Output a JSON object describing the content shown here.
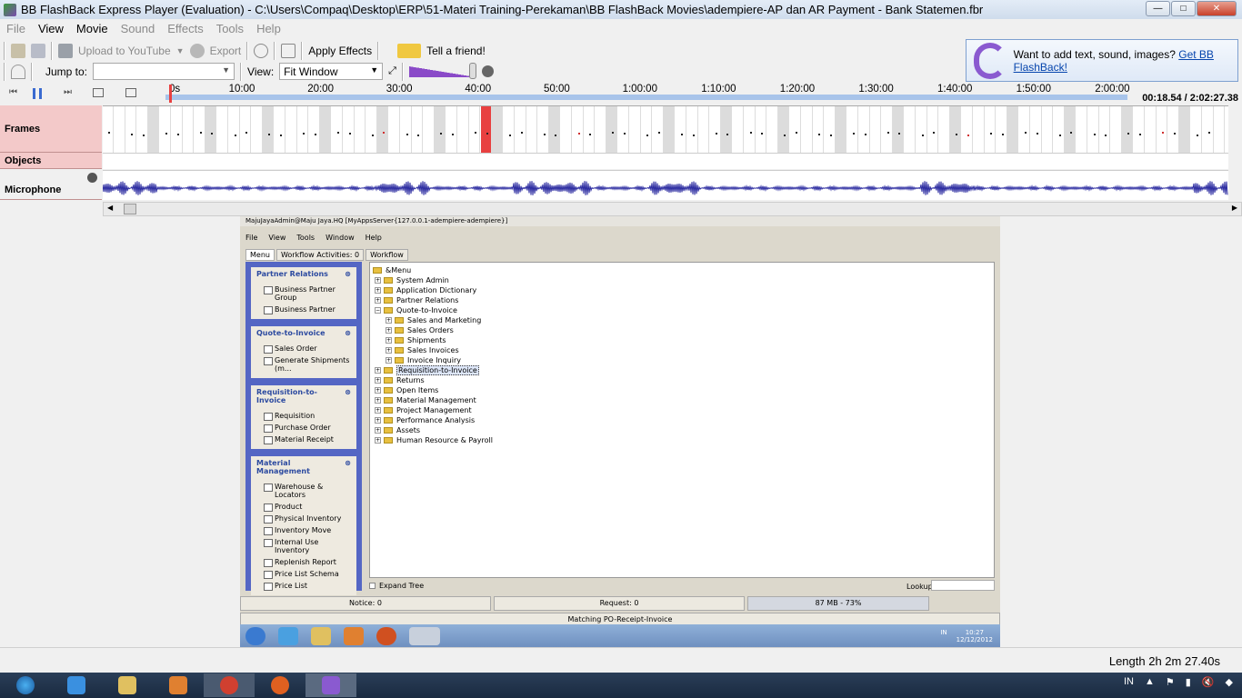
{
  "window": {
    "title": "BB FlashBack Express Player (Evaluation) - C:\\Users\\Compaq\\Desktop\\ERP\\51-Materi Training-Perekaman\\BB FlashBack Movies\\adempiere-AP dan AR Payment - Bank Statemen.fbr",
    "minimize": "—",
    "maximize": "□",
    "close": "✕"
  },
  "menu": [
    {
      "label": "File",
      "enabled": false
    },
    {
      "label": "View",
      "enabled": true
    },
    {
      "label": "Movie",
      "enabled": true
    },
    {
      "label": "Sound",
      "enabled": false
    },
    {
      "label": "Effects",
      "enabled": false
    },
    {
      "label": "Tools",
      "enabled": false
    },
    {
      "label": "Help",
      "enabled": false
    }
  ],
  "toolbar": {
    "upload": "Upload to YouTube",
    "export": "Export",
    "apply_effects": "Apply Effects",
    "tell_friend": "Tell a friend!",
    "jump_to": "Jump to:",
    "jump_value": "",
    "view": "View:",
    "view_value": "Fit Window"
  },
  "promo": {
    "text": "Want to add text, sound, images?",
    "link": "Get BB FlashBack!"
  },
  "timeline": {
    "ticks": [
      "0s",
      "10:00",
      "20:00",
      "30:00",
      "40:00",
      "50:00",
      "1:00:00",
      "1:10:00",
      "1:20:00",
      "1:30:00",
      "1:40:00",
      "1:50:00",
      "2:00:00"
    ],
    "timecode": "00:18.54 / 2:02:27.38",
    "tracks": [
      "Frames",
      "Objects",
      "Microphone"
    ],
    "playhead_fraction": 0.0025,
    "accent": "#e84040"
  },
  "recording": {
    "title": "MajuJayaAdmin@Maju Jaya.HQ [MyAppsServer{127.0.0.1-adempiere-adempiere}]",
    "menu": [
      "File",
      "View",
      "Tools",
      "Window",
      "Help"
    ],
    "tabs": [
      "Menu",
      "Workflow Activities: 0",
      "Workflow"
    ],
    "panels": [
      {
        "title": "Partner Relations",
        "items": [
          "Business Partner Group",
          "Business Partner"
        ]
      },
      {
        "title": "Quote-to-Invoice",
        "items": [
          "Sales Order",
          "Generate Shipments (m..."
        ]
      },
      {
        "title": "Requisition-to-Invoice",
        "items": [
          "Requisition",
          "Purchase Order",
          "Material Receipt"
        ]
      },
      {
        "title": "Material Management",
        "items": [
          "Warehouse & Locators",
          "Product",
          "Physical Inventory",
          "Inventory Move",
          "Internal Use Inventory",
          "Replenish Report",
          "Price List Schema",
          "Price List"
        ]
      }
    ],
    "tree": [
      {
        "label": "&Menu",
        "level": 0,
        "root": true
      },
      {
        "label": "System Admin",
        "level": 1
      },
      {
        "label": "Application Dictionary",
        "level": 1
      },
      {
        "label": "Partner Relations",
        "level": 1
      },
      {
        "label": "Quote-to-Invoice",
        "level": 1,
        "open": true
      },
      {
        "label": "Sales and Marketing",
        "level": 2
      },
      {
        "label": "Sales Orders",
        "level": 2
      },
      {
        "label": "Shipments",
        "level": 2
      },
      {
        "label": "Sales Invoices",
        "level": 2
      },
      {
        "label": "Invoice Inquiry",
        "level": 2
      },
      {
        "label": "Requisition-to-Invoice",
        "level": 1,
        "selected": true
      },
      {
        "label": "Returns",
        "level": 1
      },
      {
        "label": "Open Items",
        "level": 1
      },
      {
        "label": "Material Management",
        "level": 1
      },
      {
        "label": "Project Management",
        "level": 1
      },
      {
        "label": "Performance Analysis",
        "level": 1
      },
      {
        "label": "Assets",
        "level": 1
      },
      {
        "label": "Human Resource & Payroll",
        "level": 1
      }
    ],
    "expand_tree": "Expand Tree",
    "lookup": "Lookup",
    "notice": "Notice: 0",
    "request": "Request: 0",
    "memory": "87 MB - 73%",
    "status": "Matching PO-Receipt-Invoice",
    "tray_lang": "IN",
    "tray_time": "10:27",
    "tray_date": "12/12/2012"
  },
  "status": {
    "length": "Length 2h 2m 27.40s"
  },
  "taskbar": {
    "lang": "IN"
  }
}
